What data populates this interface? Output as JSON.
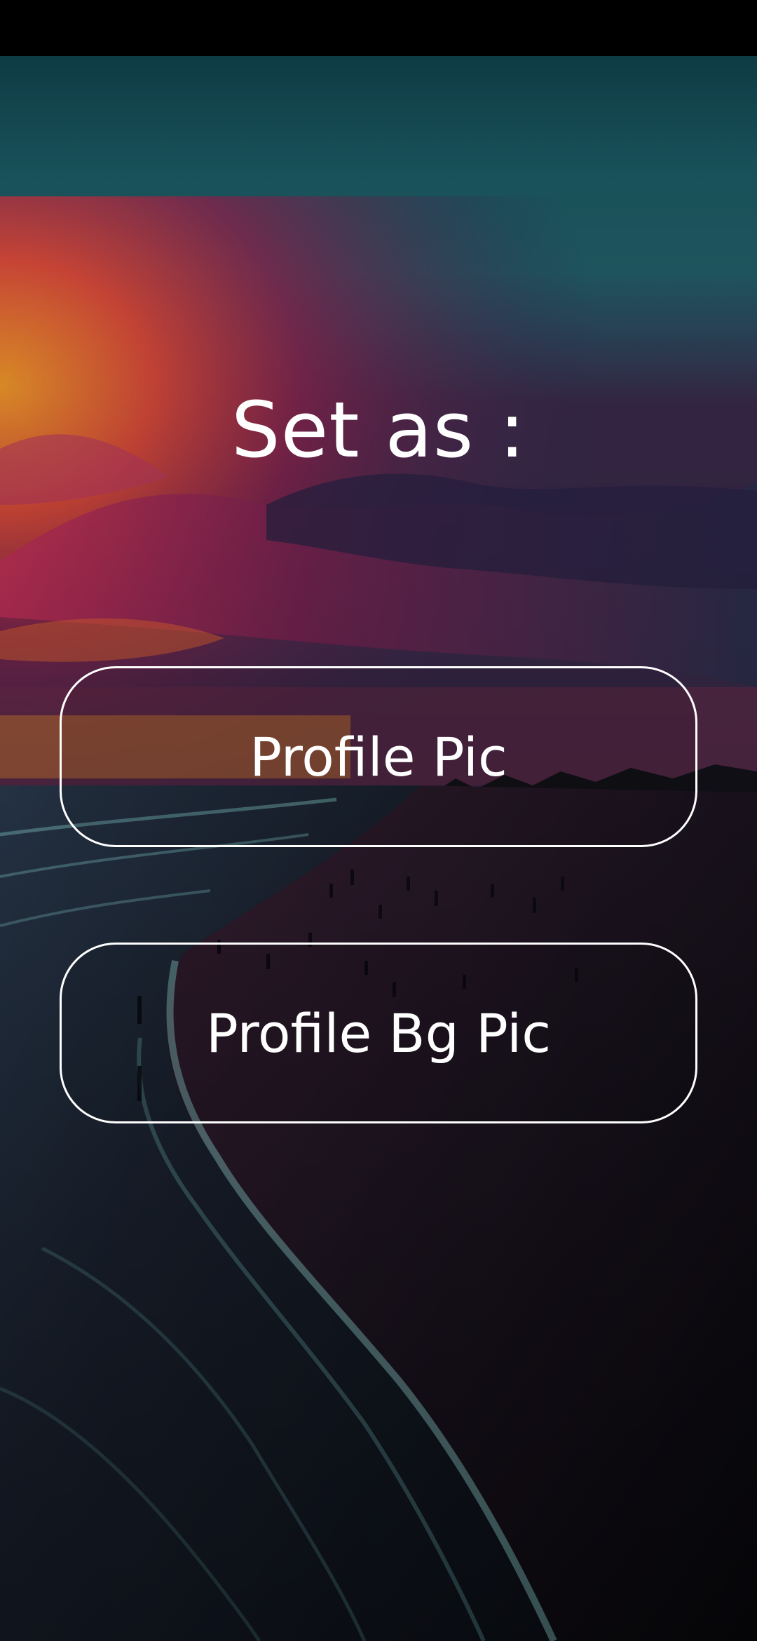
{
  "dialog": {
    "title": "Set as :",
    "options": [
      {
        "label": "Profile Pic"
      },
      {
        "label": "Profile Bg Pic"
      }
    ]
  },
  "wallpaper": {
    "subject": "beach at sunset",
    "colors": {
      "sky_top": "#14474f",
      "sky_mid": "#1e5962",
      "sunset_orange": "#e0842a",
      "sunset_magenta": "#a8264f",
      "sand_dark": "#0b0b10",
      "wave_foam": "#5fa8a8"
    }
  },
  "colors": {
    "status_bar": "#000000",
    "text": "#ffffff",
    "button_border": "#ffffff"
  }
}
